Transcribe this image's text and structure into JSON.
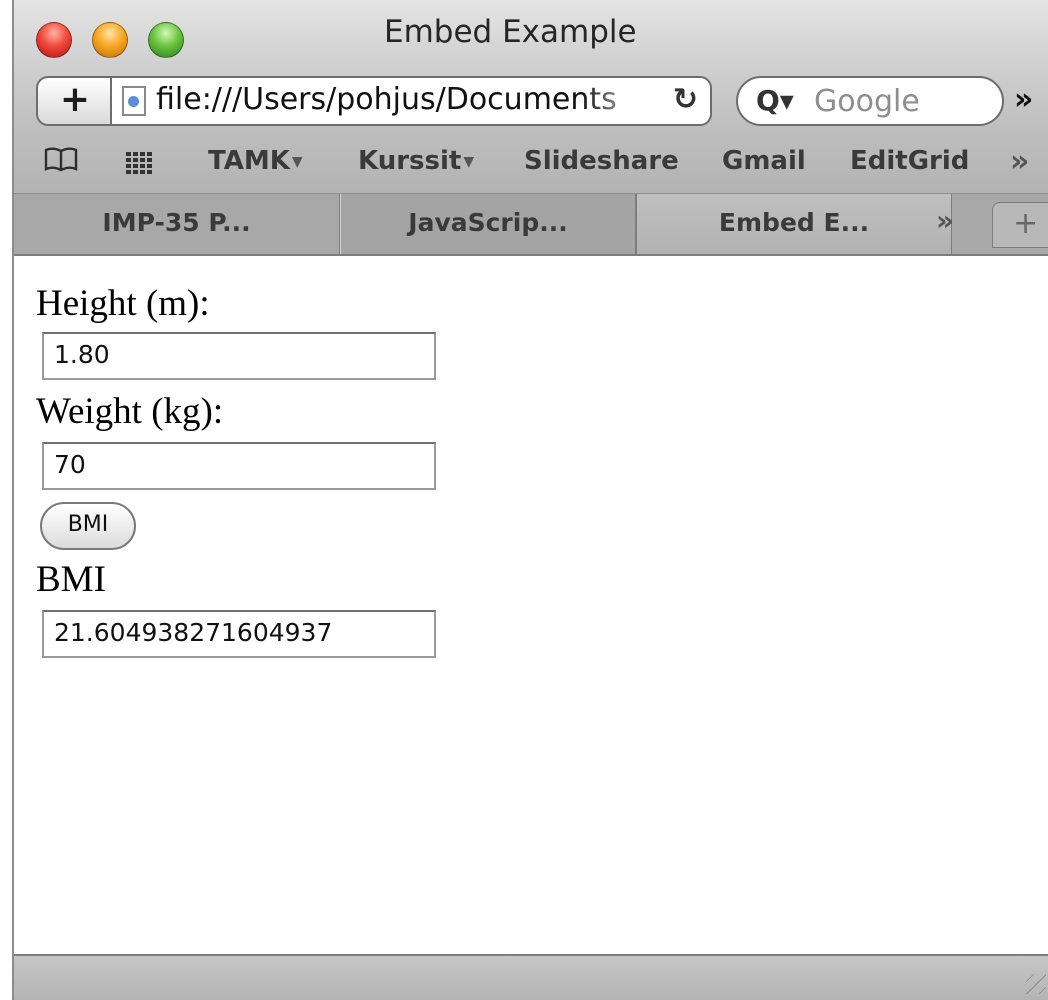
{
  "window": {
    "title": "Embed Example"
  },
  "navbar": {
    "add_label": "+",
    "url": "file:///Users/pohjus/Documents",
    "reload_glyph": "↻",
    "search_icon_glyph": "Q▾",
    "search_placeholder": "Google",
    "overflow_glyph": "»"
  },
  "bookmarks": {
    "bookmarks_icon_glyph": "🕮",
    "items": [
      {
        "label": "TAMK",
        "has_menu": true
      },
      {
        "label": "Kurssit",
        "has_menu": true
      },
      {
        "label": "Slideshare",
        "has_menu": false
      },
      {
        "label": "Gmail",
        "has_menu": false
      },
      {
        "label": "EditGrid",
        "has_menu": false
      }
    ],
    "menu_arrow": "▼",
    "overflow_glyph": "»"
  },
  "tabs": {
    "items": [
      {
        "label": "IMP-35 P...",
        "active": false
      },
      {
        "label": "JavaScrip...",
        "active": false
      },
      {
        "label": "Embed E...",
        "active": true
      }
    ],
    "overflow_glyph": "»",
    "new_tab_label": "+"
  },
  "form": {
    "height_label": "Height (m):",
    "height_value": "1.80",
    "weight_label": "Weight (kg):",
    "weight_value": "70",
    "bmi_button_label": "BMI",
    "bmi_label": "BMI",
    "bmi_value": "21.604938271604937"
  },
  "colors": {
    "close": "#f0493c",
    "minimize": "#f7a824",
    "zoom": "#68c43e"
  }
}
